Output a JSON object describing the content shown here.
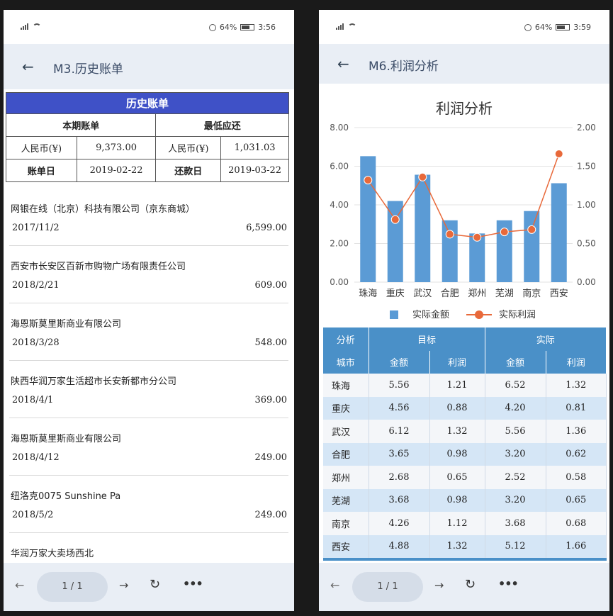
{
  "left": {
    "status": {
      "battery": "64%",
      "time": "3:56"
    },
    "title": "M3.历史账单",
    "bill": {
      "header": "历史账单",
      "current_bill_label": "本期账单",
      "min_payment_label": "最低应还",
      "currency1": "人民币(¥)",
      "current_amount": "9,373.00",
      "currency2": "人民币(¥)",
      "min_amount": "1,031.03",
      "bill_date_label": "账单日",
      "bill_date": "2019-02-22",
      "due_date_label": "还款日",
      "due_date": "2019-03-22"
    },
    "transactions": [
      {
        "merchant": "网银在线（北京）科技有限公司（京东商城）",
        "date": "2017/11/2",
        "amount": "6,599.00"
      },
      {
        "merchant": "西安市长安区百新市购物广场有限责任公司",
        "date": "2018/2/21",
        "amount": "609.00"
      },
      {
        "merchant": "海恩斯莫里斯商业有限公司",
        "date": "2018/3/28",
        "amount": "548.00"
      },
      {
        "merchant": "陕西华润万家生活超市长安新都市分公司",
        "date": "2018/4/1",
        "amount": "369.00"
      },
      {
        "merchant": "海恩斯莫里斯商业有限公司",
        "date": "2018/4/12",
        "amount": "249.00"
      },
      {
        "merchant": "纽洛克0075 Sunshine Pa",
        "date": "2018/5/2",
        "amount": "249.00"
      },
      {
        "merchant": "华润万家大卖场西北",
        "date": "",
        "amount": ""
      }
    ],
    "pager": "1 / 1"
  },
  "right": {
    "status": {
      "battery": "64%",
      "time": "3:59"
    },
    "title": "M6.利润分析",
    "chart_data": {
      "type": "bar",
      "title": "利润分析",
      "categories": [
        "珠海",
        "重庆",
        "武汉",
        "合肥",
        "郑州",
        "芜湖",
        "南京",
        "西安"
      ],
      "series": [
        {
          "name": "实际金额",
          "type": "bar",
          "axis": "left",
          "values": [
            6.52,
            4.2,
            5.56,
            3.2,
            2.52,
            3.2,
            3.68,
            5.12
          ]
        },
        {
          "name": "实际利润",
          "type": "line",
          "axis": "right",
          "values": [
            1.32,
            0.81,
            1.36,
            0.62,
            0.58,
            0.65,
            0.68,
            1.66
          ]
        }
      ],
      "y_left_ticks": [
        "0.00",
        "2.00",
        "4.00",
        "6.00",
        "8.00"
      ],
      "y_right_ticks": [
        "0.00",
        "0.50",
        "1.00",
        "1.50",
        "2.00"
      ],
      "ylim_left": [
        0,
        8
      ],
      "ylim_right": [
        0,
        2
      ],
      "legend_position": "bottom",
      "grid": true
    },
    "table": {
      "h_analysis": "分析",
      "h_target": "目标",
      "h_actual": "实际",
      "h_city": "城市",
      "h_amount1": "金额",
      "h_profit1": "利润",
      "h_amount2": "金额",
      "h_profit2": "利润",
      "rows": [
        [
          "珠海",
          "5.56",
          "1.21",
          "6.52",
          "1.32"
        ],
        [
          "重庆",
          "4.56",
          "0.88",
          "4.20",
          "0.81"
        ],
        [
          "武汉",
          "6.12",
          "1.32",
          "5.56",
          "1.36"
        ],
        [
          "合肥",
          "3.65",
          "0.98",
          "3.20",
          "0.62"
        ],
        [
          "郑州",
          "2.68",
          "0.65",
          "2.52",
          "0.58"
        ],
        [
          "芜湖",
          "3.68",
          "0.98",
          "3.20",
          "0.65"
        ],
        [
          "南京",
          "4.26",
          "1.12",
          "3.68",
          "0.68"
        ],
        [
          "西安",
          "4.88",
          "1.32",
          "5.12",
          "1.66"
        ]
      ]
    },
    "pager": "1 / 1"
  },
  "colors": {
    "bar": "#5b9bd5",
    "line": "#e8693a",
    "bill_header": "#3f51c7",
    "table_header": "#4a90c8",
    "chrome": "#e9eef5"
  },
  "icons": {
    "back": "arrow-left-icon",
    "prev": "arrow-left-icon",
    "next": "arrow-right-icon",
    "refresh": "refresh-icon",
    "more": "more-icon"
  }
}
